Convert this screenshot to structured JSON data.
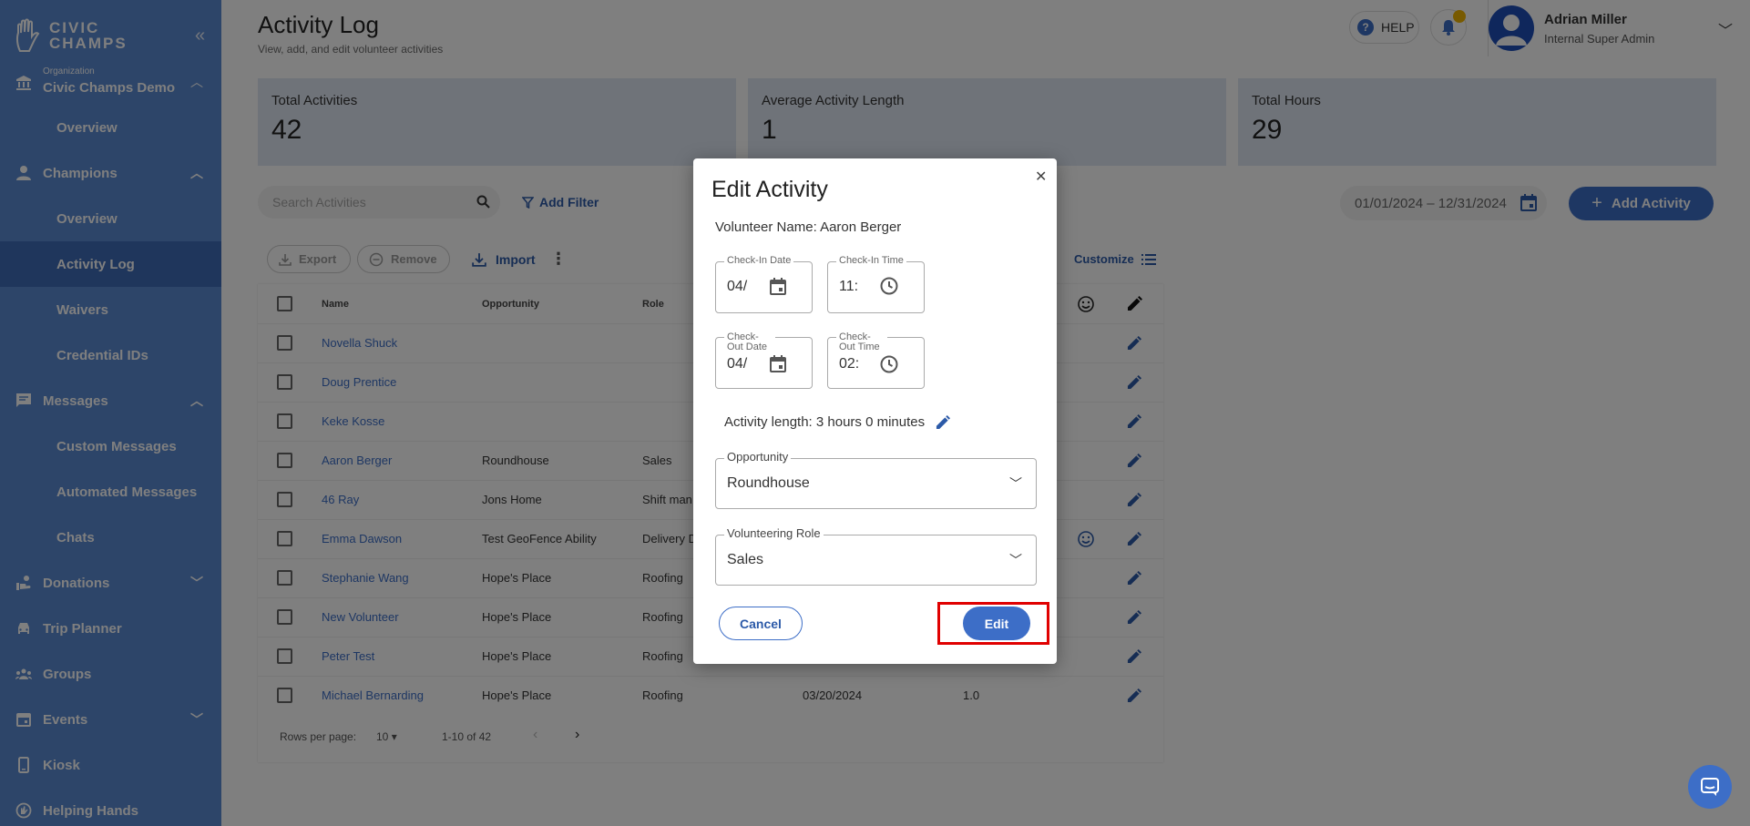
{
  "sidebar": {
    "logo_line1": "CIVIC",
    "logo_line2": "CHAMPS",
    "org_label": "Organization",
    "org_name": "Civic Champs Demo",
    "items": {
      "org_overview": "Overview",
      "champions": "Champions",
      "champ_overview": "Overview",
      "activity_log": "Activity Log",
      "waivers": "Waivers",
      "credential_ids": "Credential IDs",
      "messages": "Messages",
      "custom_messages": "Custom Messages",
      "automated_messages": "Automated Messages",
      "chats": "Chats",
      "donations": "Donations",
      "trip_planner": "Trip Planner",
      "groups": "Groups",
      "events": "Events",
      "kiosk": "Kiosk",
      "helping_hands": "Helping Hands"
    }
  },
  "header": {
    "title": "Activity Log",
    "subtitle": "View, add, and edit volunteer activities",
    "help": "HELP",
    "user_name": "Adrian Miller",
    "user_role": "Internal Super Admin"
  },
  "stats": [
    {
      "label": "Total Activities",
      "value": "42"
    },
    {
      "label": "Average Activity Length",
      "value": "1"
    },
    {
      "label": "Total Hours",
      "value": "29"
    }
  ],
  "toolbar": {
    "search_placeholder": "Search Activities",
    "add_filter": "Add Filter",
    "date_range": "01/01/2024 – 12/31/2024",
    "add_activity": "Add Activity",
    "export": "Export",
    "remove": "Remove",
    "import": "Import",
    "customize": "Customize"
  },
  "table": {
    "headers": {
      "name": "Name",
      "opportunity": "Opportunity",
      "role": "Role"
    },
    "rows": [
      {
        "name": "Novella Shuck",
        "opportunity": "",
        "role": "",
        "date": "",
        "length": ""
      },
      {
        "name": "Doug Prentice",
        "opportunity": "",
        "role": "",
        "date": "",
        "length": ""
      },
      {
        "name": "Keke Kosse",
        "opportunity": "",
        "role": "",
        "date": "",
        "length": ""
      },
      {
        "name": "Aaron Berger",
        "opportunity": "Roundhouse",
        "role": "Sales",
        "date": "",
        "length": ""
      },
      {
        "name": "46 Ray",
        "opportunity": "Jons Home",
        "role": "Shift man",
        "date": "",
        "length": ""
      },
      {
        "name": "Emma Dawson",
        "opportunity": "Test GeoFence Ability",
        "role": "Delivery D",
        "date": "",
        "length": ""
      },
      {
        "name": "Stephanie Wang",
        "opportunity": "Hope's Place",
        "role": "Roofing",
        "date": "",
        "length": ""
      },
      {
        "name": "New Volunteer",
        "opportunity": "Hope's Place",
        "role": "Roofing",
        "date": "",
        "length": ""
      },
      {
        "name": "Peter Test",
        "opportunity": "Hope's Place",
        "role": "Roofing",
        "date": "",
        "length": ""
      },
      {
        "name": "Michael Bernarding",
        "opportunity": "Hope's Place",
        "role": "Roofing",
        "date": "03/20/2024",
        "length": "1.0"
      }
    ],
    "rows_per_page_label": "Rows per page:",
    "rows_per_page": "10",
    "range": "1-10 of 42"
  },
  "modal": {
    "title": "Edit Activity",
    "volunteer": "Volunteer Name: Aaron Berger",
    "checkin_date_label": "Check-In Date",
    "checkin_date_value": "04/",
    "checkin_time_label": "Check-In Time",
    "checkin_time_value": "11:",
    "checkout_date_label": "Check-Out Date",
    "checkout_date_value": "04/",
    "checkout_time_label": "Check-Out Time",
    "checkout_time_value": "02:",
    "activity_length": "Activity length: 3 hours 0 minutes",
    "opportunity_label": "Opportunity",
    "opportunity_value": "Roundhouse",
    "role_label": "Volunteering Role",
    "role_value": "Sales",
    "cancel": "Cancel",
    "edit": "Edit"
  },
  "colors": {
    "sidebar": "#5b8ad3",
    "primary": "#3d6ec7",
    "highlight": "#e00000"
  }
}
